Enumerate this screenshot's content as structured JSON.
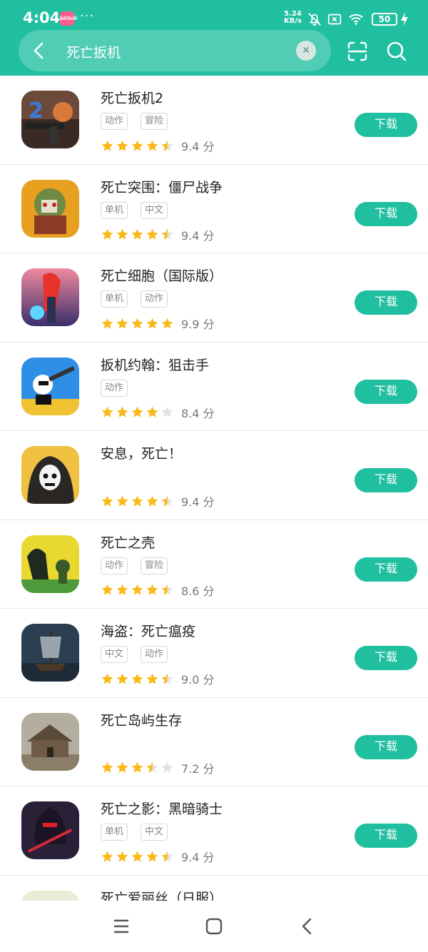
{
  "status_bar": {
    "time": "4:04",
    "app_badge": "bilibili",
    "more": "···",
    "speed_value": "5.24",
    "speed_unit": "KB/s",
    "battery": "50"
  },
  "search": {
    "query": "死亡扳机",
    "clear_icon": "close-icon"
  },
  "theme": {
    "accent": "#1fbf9f",
    "star": "#fbb917"
  },
  "apps": [
    {
      "name": "死亡扳机2",
      "tags": [
        "动作",
        "冒险"
      ],
      "stars": 4.5,
      "score": "9.4 分",
      "button": "下载"
    },
    {
      "name": "死亡突围：僵尸战争",
      "tags": [
        "单机",
        "中文"
      ],
      "stars": 4.5,
      "score": "9.4 分",
      "button": "下载"
    },
    {
      "name": "死亡细胞（国际版）",
      "tags": [
        "单机",
        "动作"
      ],
      "stars": 5,
      "score": "9.9 分",
      "button": "下载"
    },
    {
      "name": "扳机约翰：狙击手",
      "tags": [
        "动作"
      ],
      "stars": 4,
      "score": "8.4 分",
      "button": "下载"
    },
    {
      "name": "安息，死亡！",
      "tags": [],
      "stars": 4.5,
      "score": "9.4 分",
      "button": "下载"
    },
    {
      "name": "死亡之壳",
      "tags": [
        "动作",
        "冒险"
      ],
      "stars": 4.5,
      "score": "8.6 分",
      "button": "下载"
    },
    {
      "name": "海盗：死亡瘟疫",
      "tags": [
        "中文",
        "动作"
      ],
      "stars": 4.5,
      "score": "9.0 分",
      "button": "下载"
    },
    {
      "name": "死亡岛屿生存",
      "tags": [],
      "stars": 3.5,
      "score": "7.2 分",
      "button": "下载"
    },
    {
      "name": "死亡之影：黑暗骑士",
      "tags": [
        "单机",
        "中文"
      ],
      "stars": 4.5,
      "score": "9.4 分",
      "button": "下载"
    },
    {
      "name": "死亡爱丽丝（日服）",
      "tags": [],
      "stars": 0,
      "score": "",
      "button": ""
    }
  ],
  "nav": {
    "menu": "menu-icon",
    "home": "home-icon",
    "back": "back-icon"
  }
}
